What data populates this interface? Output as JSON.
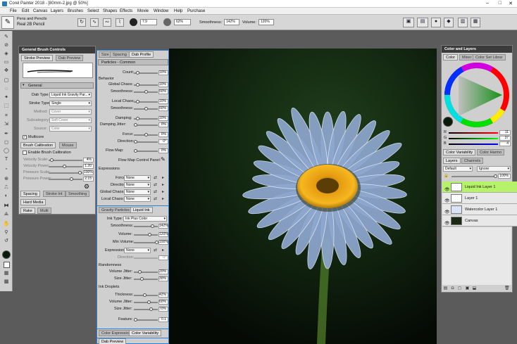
{
  "app": {
    "title": "Corel Painter 2018 - [80mm-2.jpg @ 50%]"
  },
  "menu": [
    "File",
    "Edit",
    "Canvas",
    "Layers",
    "Brushes",
    "Select",
    "Shapes",
    "Effects",
    "Movie",
    "Window",
    "Help",
    "Purchase"
  ],
  "brush_selector": {
    "category": "Pens and Pencils",
    "variant": "Real 2B Pencil"
  },
  "property_bar": {
    "size": "7.9",
    "opacity": "62%",
    "smoothness_label": "Smoothness:",
    "smoothness": "142%",
    "volume_label": "Volume:",
    "volume": "120%"
  },
  "general_panel": {
    "title": "General Brush Controls",
    "tabs": [
      "Stroke Preview",
      "Dab Preview"
    ],
    "general": {
      "label": "General",
      "dab_type_label": "Dab Type:",
      "dab_type": "Liquid Ink Gravity Par...",
      "stroke_type_label": "Stroke Type:",
      "stroke_type": "Single",
      "method_label": "Method:",
      "method": "Cover",
      "subcategory_label": "Subcategory:",
      "subcategory": "Soft Cover",
      "source_label": "Source:",
      "source": "Color",
      "multicore": "Multicore"
    },
    "calibration": {
      "tabs": [
        "Brush Calibration",
        "Mouse"
      ],
      "enable": "Enable Brush Calibration",
      "velocity_scale_label": "Velocity Scale:",
      "velocity_scale": "4%",
      "velocity_power_label": "Velocity Power:",
      "velocity_power": "1.20",
      "pressure_scale_label": "Pressure Scale:",
      "pressure_scale": "100%",
      "pressure_power_label": "Pressure Power:",
      "pressure_power": "2.15"
    },
    "bottom_tabs": [
      [
        "Spacing",
        "Stroke Int",
        "Smoothing"
      ],
      [
        "Hard Media"
      ],
      [
        "Rake",
        "Multi"
      ]
    ]
  },
  "particles_panel": {
    "tabs": [
      "Size",
      "Spacing",
      "Dab Profile"
    ],
    "section": "Particles - Common",
    "count_label": "Count:",
    "count": "10%",
    "behavior": "Behavior",
    "global_chaos_label": "Global Chaos:",
    "global_chaos": "10%",
    "smoothness_label": "Smoothness:",
    "smoothness": "50%",
    "local_chaos_label": "Local Chaos:",
    "local_chaos": "10%",
    "smoothness2": "50%",
    "damping_label": "Damping:",
    "damping": "10%",
    "damping_jitter_label": "Damping Jitter:",
    "damping_jitter": "0%",
    "force_label": "Force:",
    "force": "0%",
    "direction_label": "Direction:",
    "direction": "0°",
    "flow_map_label": "Flow Map:",
    "flow_map": "0%",
    "flow_map_panel": "Flow Map Control Panel:",
    "expressions": "Expressions",
    "expr_rows": [
      {
        "label": "Force:",
        "value": "None"
      },
      {
        "label": "Direction:",
        "value": "None"
      },
      {
        "label": "Global Chaos:",
        "value": "None"
      },
      {
        "label": "Local Chaos:",
        "value": "None"
      }
    ]
  },
  "liquid_panel": {
    "tabs": [
      "Gravity Particles",
      "Liquid Ink"
    ],
    "ink_type_label": "Ink Type:",
    "ink_type": "Ink Plus Color",
    "smoothness_label": "Smoothness:",
    "smoothness": "142%",
    "volume_label": "Volume:",
    "volume": "120%",
    "min_volume_label": "Min Volume:",
    "min_volume": "100%",
    "expression_label": "Expression:",
    "expression": "None",
    "direction_label": "Direction:",
    "direction": "0°",
    "randomness": "Randomness",
    "volume_jitter_label": "Volume Jitter:",
    "volume_jitter": "20%",
    "size_jitter_label": "Size Jitter:",
    "size_jitter": "30%",
    "ink_droplets": "Ink Droplets",
    "thickness_label": "Thickness:",
    "thickness": "42%",
    "volume_jitter2": "60%",
    "size_jitter2": "70%",
    "feature_label": "Feature:",
    "feature": "0.1",
    "bottom_tabs": [
      "Color Expression",
      "Color Variability"
    ],
    "dab_preview": "Dab Preview"
  },
  "color_panel": {
    "title": "Color and Layers",
    "tabs": [
      "Color",
      "Mixer",
      "Color Set Librar"
    ],
    "r_label": "R",
    "r": "11",
    "g_label": "G",
    "g": "37",
    "b_label": "B",
    "b": "4",
    "variability_tabs": [
      "Color Variability",
      "Color Harmo"
    ]
  },
  "layers_panel": {
    "tabs": [
      "Layers",
      "Channels"
    ],
    "composite": "Default",
    "method": "Ignore",
    "opacity": "100%",
    "layers": [
      {
        "name": "Liquid Ink Layer 1",
        "selected": true
      },
      {
        "name": "Layer 1",
        "selected": false
      },
      {
        "name": "Watercolor Layer 1",
        "selected": false
      },
      {
        "name": "Canvas",
        "selected": false
      }
    ]
  },
  "colors": {
    "accent": "#2a7ab8",
    "panel": "#cfcfcf",
    "selected_layer": "#b7f36a",
    "stem_green": "#4f7d2a",
    "petal": "#8ea7cf",
    "center": "#f2a514"
  }
}
